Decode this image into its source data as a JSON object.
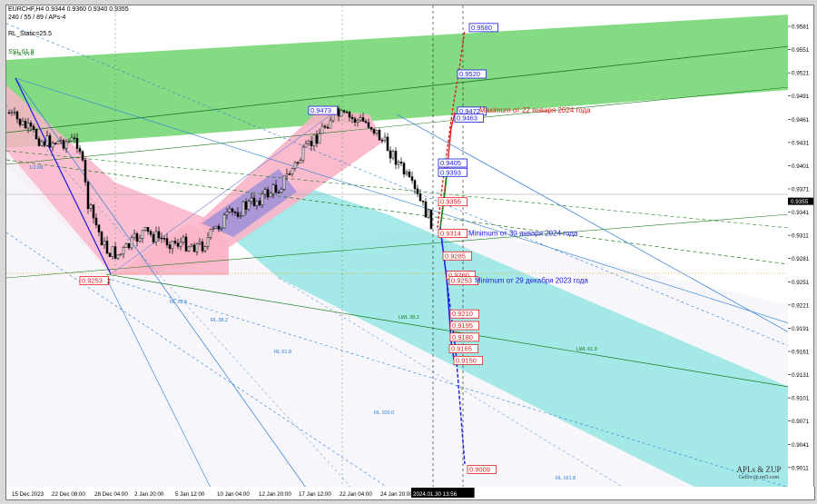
{
  "header": {
    "line1": "EURCHF,H4  0.9344 0.9360 0.9340 0.9355",
    "line2": "240 / 55 / 89 / APs-4",
    "line3": "RL_Static=25.5",
    "line4": "SSL 61.8"
  },
  "colors": {
    "green_channel": "#6fd56f",
    "pink_channel": "#f9b4c8",
    "cyan_channel": "#8fe3e3",
    "purple_zone": "#9b8fd8",
    "blue_label": "#1a1adf",
    "red_label": "#e02020",
    "candle": "#000000"
  },
  "chart_data": {
    "type": "candlestick",
    "symbol": "EURCHF",
    "timeframe": "H4",
    "ylim": [
      0.8985,
      0.9608
    ],
    "y_ticks": [
      "0.9581",
      "0.9551",
      "0.9521",
      "0.9491",
      "0.9461",
      "0.9431",
      "0.9401",
      "0.9371",
      "0.9341",
      "0.9311",
      "0.9281",
      "0.9251",
      "0.9221",
      "0.9191",
      "0.9161",
      "0.9131",
      "0.9101",
      "0.9071",
      "0.9041",
      "0.9011"
    ],
    "current_price": "0.9355",
    "x_ticks": [
      "15 Dec 2023",
      "22 Dec 08:00",
      "28 Dec 04:00",
      "2 Jan 20:00",
      "5 Jan 12:00",
      "10 Jan 04:00",
      "12 Jan 20:00",
      "17 Jan 12:00",
      "22 Jan 04:00",
      "24 Jan 20:00",
      "2024.01.30 13:56"
    ],
    "price_boxes_blue": [
      "0.9580",
      "0.9520",
      "0.9472",
      "0.9473",
      "0.9463",
      "0.9405",
      "0.9393"
    ],
    "price_boxes_red": [
      "0.9355",
      "0.9314",
      "0.9285",
      "0.9260",
      "0.9253",
      "0.9253",
      "0.9210",
      "0.9195",
      "0.9180",
      "0.9165",
      "0.9150",
      "0.9009"
    ],
    "annotations": {
      "max_label": "Maximum от 22 января 2024 года",
      "min_jan30": "Minimum от 30 января 2024 года",
      "min_dec29": "Minimum от 29 декабря 2023 года",
      "point_2": "2"
    },
    "line_labels": [
      "FSL 61.8",
      "LWL 38.2",
      "LWL 61.8",
      "RL 23.6",
      "RL 38.2",
      "RL 61.8",
      "RL 100.0",
      "RL 161.8",
      "1/2 ML"
    ],
    "signature": "APLs & ZUP",
    "signature_sub": "Gelox @ mt5.com"
  }
}
